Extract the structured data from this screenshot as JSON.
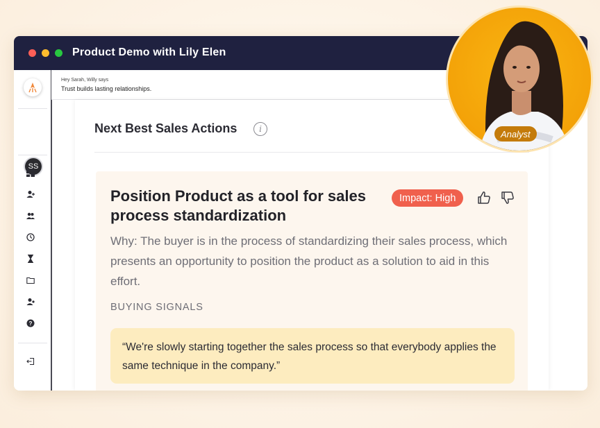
{
  "window": {
    "title": "Product Demo with Lily Elen"
  },
  "greeting": {
    "intro": "Hey Sarah, Willy says",
    "message": "Trust builds lasting relationships."
  },
  "sidebar": {
    "avatar_initials": "SS",
    "icons": [
      "dashboard-icon",
      "add-user-icon",
      "group-icon",
      "clock-icon",
      "hourglass-icon",
      "folder-icon",
      "user-settings-icon",
      "help-icon",
      "logout-icon"
    ]
  },
  "panel": {
    "title": "Next Best Sales Actions",
    "info_glyph": "i"
  },
  "card": {
    "title": "Position Product as a tool for sales process standardization",
    "impact": "Impact: High",
    "why": "Why: The buyer is in the process of standardizing their sales process, which presents an opportunity to position the product as a solution to aid in this effort.",
    "signals_label": "BUYING SIGNALS",
    "quote": "“We're slowly starting together the sales process so that everybody applies the same technique in the company.”"
  },
  "analyst": {
    "label": "Analyst"
  },
  "colors": {
    "titlebar": "#1f2140",
    "impact_badge": "#f0604d",
    "quote_bg": "#fdecbf",
    "analyst_bg": "#f5a60a"
  }
}
